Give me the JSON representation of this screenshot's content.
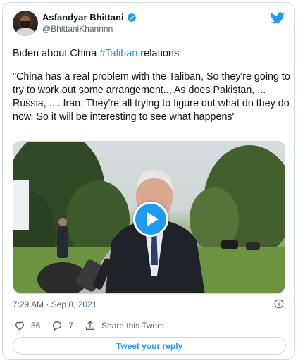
{
  "author": {
    "name": "Asfandyar Bhittani",
    "handle": "@BhittaniKhannnn",
    "verified": true
  },
  "brand_icon": "twitter-bird-icon",
  "tweet": {
    "prefix": "Biden about China ",
    "hashtag": "#Taliban",
    "suffix": " relations",
    "quote": "\"China has a real problem with the Taliban, So they're going to try to work out some arrangement.., As does Pakistan, ... Russia, .... Iran. They're all trying to figure out what do they do now. So it will be interesting to see what happens\""
  },
  "media": {
    "type": "video",
    "play_icon": "play-icon"
  },
  "timestamp": "7:29 AM · Sep 8, 2021",
  "actions": {
    "likes": "56",
    "replies": "7",
    "share_label": "Share this Tweet"
  },
  "reply_button_label": "Tweet your reply",
  "colors": {
    "accent": "#1d9bf0",
    "secondary_text": "#536471",
    "border": "#cfd9de"
  }
}
